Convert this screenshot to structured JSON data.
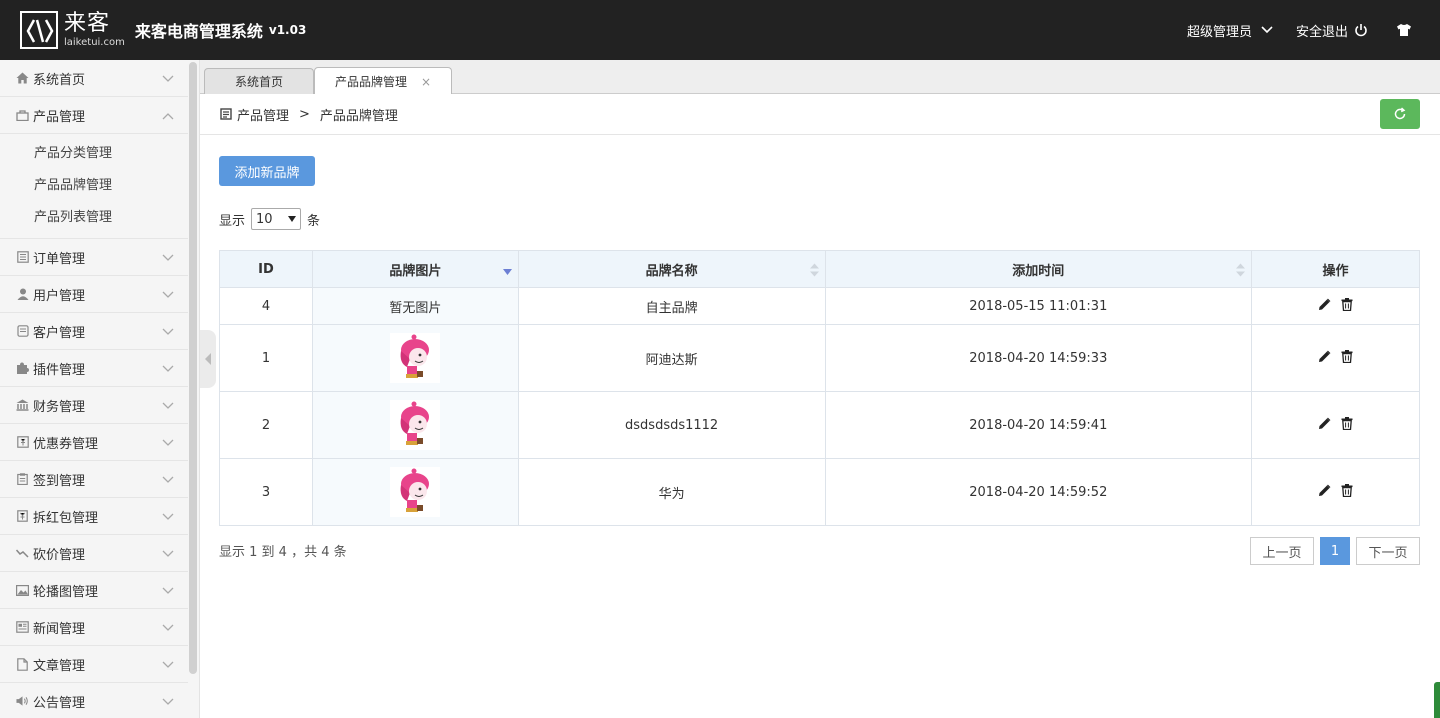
{
  "header": {
    "logo_cn": "来客",
    "logo_en": "laiketui.com",
    "title": "来客电商管理系统",
    "version": "v1.03",
    "user": "超级管理员",
    "logout": "安全退出",
    "icons": [
      "chevron-down-icon",
      "power-icon",
      "shirt-icon"
    ]
  },
  "sidebar": {
    "items": [
      {
        "label": "系统首页",
        "icon": "home-icon"
      },
      {
        "label": "产品管理",
        "icon": "bag-icon",
        "expanded": true,
        "children": [
          "产品分类管理",
          "产品品牌管理",
          "产品列表管理"
        ]
      },
      {
        "label": "订单管理",
        "icon": "list-icon"
      },
      {
        "label": "用户管理",
        "icon": "user-icon"
      },
      {
        "label": "客户管理",
        "icon": "client-icon"
      },
      {
        "label": "插件管理",
        "icon": "puzzle-icon"
      },
      {
        "label": "财务管理",
        "icon": "bank-icon"
      },
      {
        "label": "优惠券管理",
        "icon": "coupon-icon"
      },
      {
        "label": "签到管理",
        "icon": "clipboard-icon"
      },
      {
        "label": "拆红包管理",
        "icon": "redpacket-icon"
      },
      {
        "label": "砍价管理",
        "icon": "trend-icon"
      },
      {
        "label": "轮播图管理",
        "icon": "image-icon"
      },
      {
        "label": "新闻管理",
        "icon": "news-icon"
      },
      {
        "label": "文章管理",
        "icon": "file-icon"
      },
      {
        "label": "公告管理",
        "icon": "speaker-icon"
      }
    ]
  },
  "tabs": [
    {
      "label": "系统首页",
      "active": false
    },
    {
      "label": "产品品牌管理",
      "active": true,
      "close": "×"
    }
  ],
  "breadcrumb": {
    "parent": "产品管理",
    "sep": ">",
    "current": "产品品牌管理"
  },
  "toolbar": {
    "add_label": "添加新品牌",
    "length_prefix": "显示",
    "length_value": "10",
    "length_suffix": "条"
  },
  "table": {
    "columns": [
      "ID",
      "品牌图片",
      "品牌名称",
      "添加时间",
      "操作"
    ],
    "rows": [
      {
        "id": "4",
        "image": "暂无图片",
        "name": "自主品牌",
        "time": "2018-05-15 11:01:31"
      },
      {
        "id": "1",
        "image": "",
        "name": "阿迪达斯",
        "time": "2018-04-20 14:59:33"
      },
      {
        "id": "2",
        "image": "",
        "name": "dsdsdsds1112",
        "time": "2018-04-20 14:59:41"
      },
      {
        "id": "3",
        "image": "",
        "name": "华为",
        "time": "2018-04-20 14:59:52"
      }
    ]
  },
  "footer": {
    "info": "显示 1 到 4 ，共 4 条",
    "prev": "上一页",
    "page": "1",
    "next": "下一页"
  },
  "colors": {
    "header_bg": "#222222",
    "primary": "#5a98de",
    "success": "#5cb85c",
    "table_head": "#eef5fb"
  }
}
